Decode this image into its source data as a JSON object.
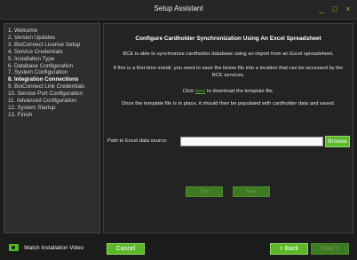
{
  "window": {
    "title": "Setup Assistant",
    "minimize": "_",
    "maximize": "□",
    "close": "×"
  },
  "sidebar": {
    "steps": [
      {
        "label": "1. Welcome"
      },
      {
        "label": "2. Version Updates"
      },
      {
        "label": "3. BioConnect License Setup"
      },
      {
        "label": "4. Service Credentials"
      },
      {
        "label": "5. Installation Type"
      },
      {
        "label": "6. Database Configuration"
      },
      {
        "label": "7. System Configuration"
      },
      {
        "label": "8. Integration Connections"
      },
      {
        "label": "9. BioConnect Link Credentials"
      },
      {
        "label": "10. Service Port Configuration"
      },
      {
        "label": "11. Advanced Configuration"
      },
      {
        "label": "12. System Startup"
      },
      {
        "label": "13. Finish"
      }
    ],
    "active_index": 7
  },
  "main": {
    "heading": "Configure Cardholder Synchronization Using An Excel Spreadsheet",
    "para1": "BCE is able to synchronize cardholder database using an import from an Excel spreadsheet.",
    "para2": "If this is a first-time install, you need to save the below file into a location that can be accessed by the BCE services.",
    "para3_prefix": "Click ",
    "para3_link": "here",
    "para3_suffix": " to download the template file.",
    "para4": "Once the template file is in place, it should then be populated with cardholder data and saved.",
    "path_label": "Path to Excel data source:",
    "path_value": "",
    "browse_label": "Browse",
    "test_label": "Test",
    "save_label": "Save"
  },
  "footer": {
    "video_label": "Watch Installation Video",
    "cancel_label": "Cancel",
    "back_label": "< Back",
    "next_label": "Next >"
  },
  "colors": {
    "accent": "#5cb82a",
    "link": "#4fbf1f",
    "disabled": "#3e7a22",
    "background": "#1b1b1b"
  }
}
